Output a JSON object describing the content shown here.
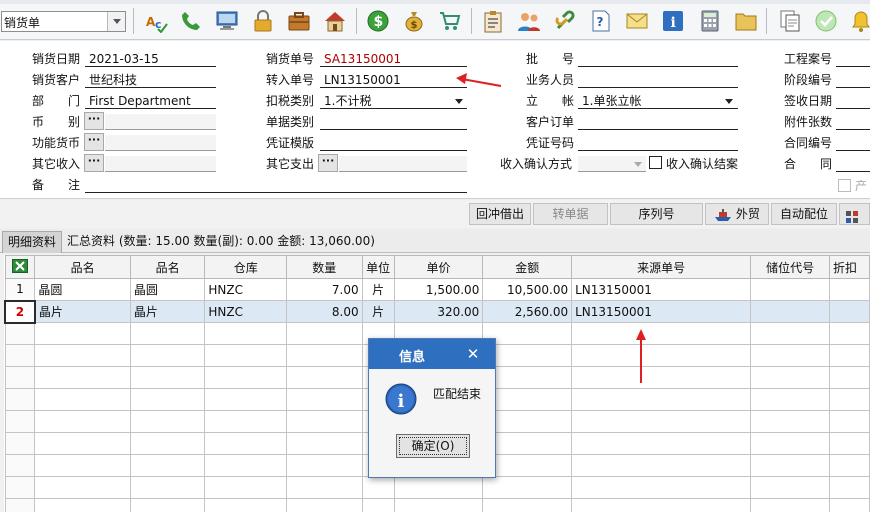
{
  "toolbar": {
    "doc_type": "销货单",
    "icons": [
      "abc-spellcheck-icon",
      "phone-icon",
      "computer-icon",
      "lock-icon",
      "briefcase-icon",
      "house-icon",
      "dollar-coin-icon",
      "money-bag-icon",
      "shopping-cart-icon",
      "clipboard-icon",
      "users-icon",
      "link-icon",
      "help-document-icon",
      "mail-icon",
      "info-icon",
      "calculator-icon",
      "folder-icon",
      "copy-document-icon",
      "check-circle-icon",
      "bell-icon"
    ]
  },
  "form": {
    "sale_date": {
      "label": "销货日期",
      "value": "2021-03-15"
    },
    "customer": {
      "label": "销货客户",
      "value": "世纪科技"
    },
    "department": {
      "label": "部　　门",
      "value": "First Department"
    },
    "currency": {
      "label": "币　　别",
      "button": "···"
    },
    "func_currency": {
      "label": "功能货币",
      "button": "···"
    },
    "other_income": {
      "label": "其它收入",
      "button": "···"
    },
    "remark": {
      "label": "备　　注",
      "value": ""
    },
    "sale_no": {
      "label": "销货单号",
      "value": "SA13150001"
    },
    "transfer_no": {
      "label": "转入单号",
      "value": "LN13150001"
    },
    "tax_type": {
      "label": "扣税类别",
      "value": "1.不计税"
    },
    "bill_type": {
      "label": "单据类别",
      "value": ""
    },
    "voucher_template": {
      "label": "凭证模版",
      "value": ""
    },
    "other_expense": {
      "label": "其它支出",
      "button": "···"
    },
    "batch": {
      "label": "批　　号",
      "value": ""
    },
    "salesperson": {
      "label": "业务人员",
      "value": ""
    },
    "account": {
      "label": "立　　帐",
      "value": "1.单张立帐"
    },
    "customer_order": {
      "label": "客户订单",
      "value": ""
    },
    "voucher_no": {
      "label": "凭证号码",
      "value": ""
    },
    "income_confirm": {
      "label": "收入确认方式",
      "value": ""
    },
    "income_confirm_close": {
      "label": "收入确认结案"
    },
    "project_no": {
      "label": "工程案号"
    },
    "stage_no": {
      "label": "阶段编号"
    },
    "sign_date": {
      "label": "签收日期"
    },
    "attachments": {
      "label": "附件张数"
    },
    "contract_no": {
      "label": "合同编号"
    },
    "contract": {
      "label": "合　　同"
    },
    "product_partial": {
      "label": "产"
    }
  },
  "actions": {
    "offset_borrow": "回冲借出",
    "convert_doc": "转单据",
    "serial_no": "序列号",
    "foreign_trade": "外贸",
    "auto_locate": "自动配位",
    "more": "扌"
  },
  "tabs": {
    "detail": "明细资料",
    "summary": "汇总资料 (数量: 15.00 数量(副): 0.00 金额: 13,060.00)"
  },
  "grid": {
    "columns": [
      "品名",
      "品名",
      "仓库",
      "数量",
      "单位",
      "单价",
      "金额",
      "来源单号",
      "储位代号",
      "折扣"
    ],
    "rows": [
      {
        "n": "1",
        "name1": "晶圆",
        "name2": "晶圆",
        "wh": "HNZC",
        "qty": "7.00",
        "unit": "片",
        "price": "1,500.00",
        "amount": "10,500.00",
        "src": "LN13150001",
        "loc": "",
        "disc": ""
      },
      {
        "n": "2",
        "name1": "晶片",
        "name2": "晶片",
        "wh": "HNZC",
        "qty": "8.00",
        "unit": "片",
        "price": "320.00",
        "amount": "2,560.00",
        "src": "LN13150001",
        "loc": "",
        "disc": ""
      }
    ]
  },
  "dialog": {
    "title": "信息",
    "message": "匹配结束",
    "ok": "确定(O)"
  }
}
